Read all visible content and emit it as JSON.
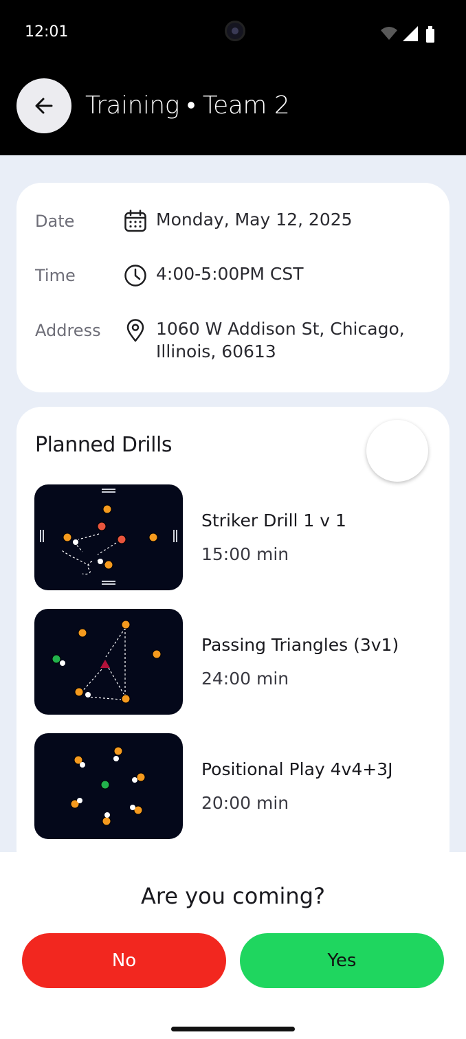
{
  "status_bar": {
    "time": "12:01"
  },
  "header": {
    "title": "Training • Team 2",
    "back_icon": "arrow-left-icon"
  },
  "details": {
    "date_label": "Date",
    "date_value": "Monday, May 12, 2025",
    "time_label": "Time",
    "time_value": "4:00-5:00PM CST",
    "address_label": "Address",
    "address_line1": "1060 W Addison St, Chicago,",
    "address_line2": "Illinois, 60613"
  },
  "drills": {
    "title": "Planned Drills",
    "items": [
      {
        "name": "Striker Drill 1 v 1",
        "duration": "15:00 min"
      },
      {
        "name": "Passing Triangles (3v1)",
        "duration": "24:00 min"
      },
      {
        "name": "Positional Play 4v4+3J",
        "duration": "20:00 min"
      }
    ]
  },
  "rsvp": {
    "question": "Are you coming?",
    "no_label": "No",
    "yes_label": "Yes"
  },
  "colors": {
    "no": "#f2271f",
    "yes": "#1fd65f",
    "player": "#f59a1e",
    "opponent": "#e8553d",
    "neutral": "#22b24c",
    "defender": "#b3123a"
  }
}
